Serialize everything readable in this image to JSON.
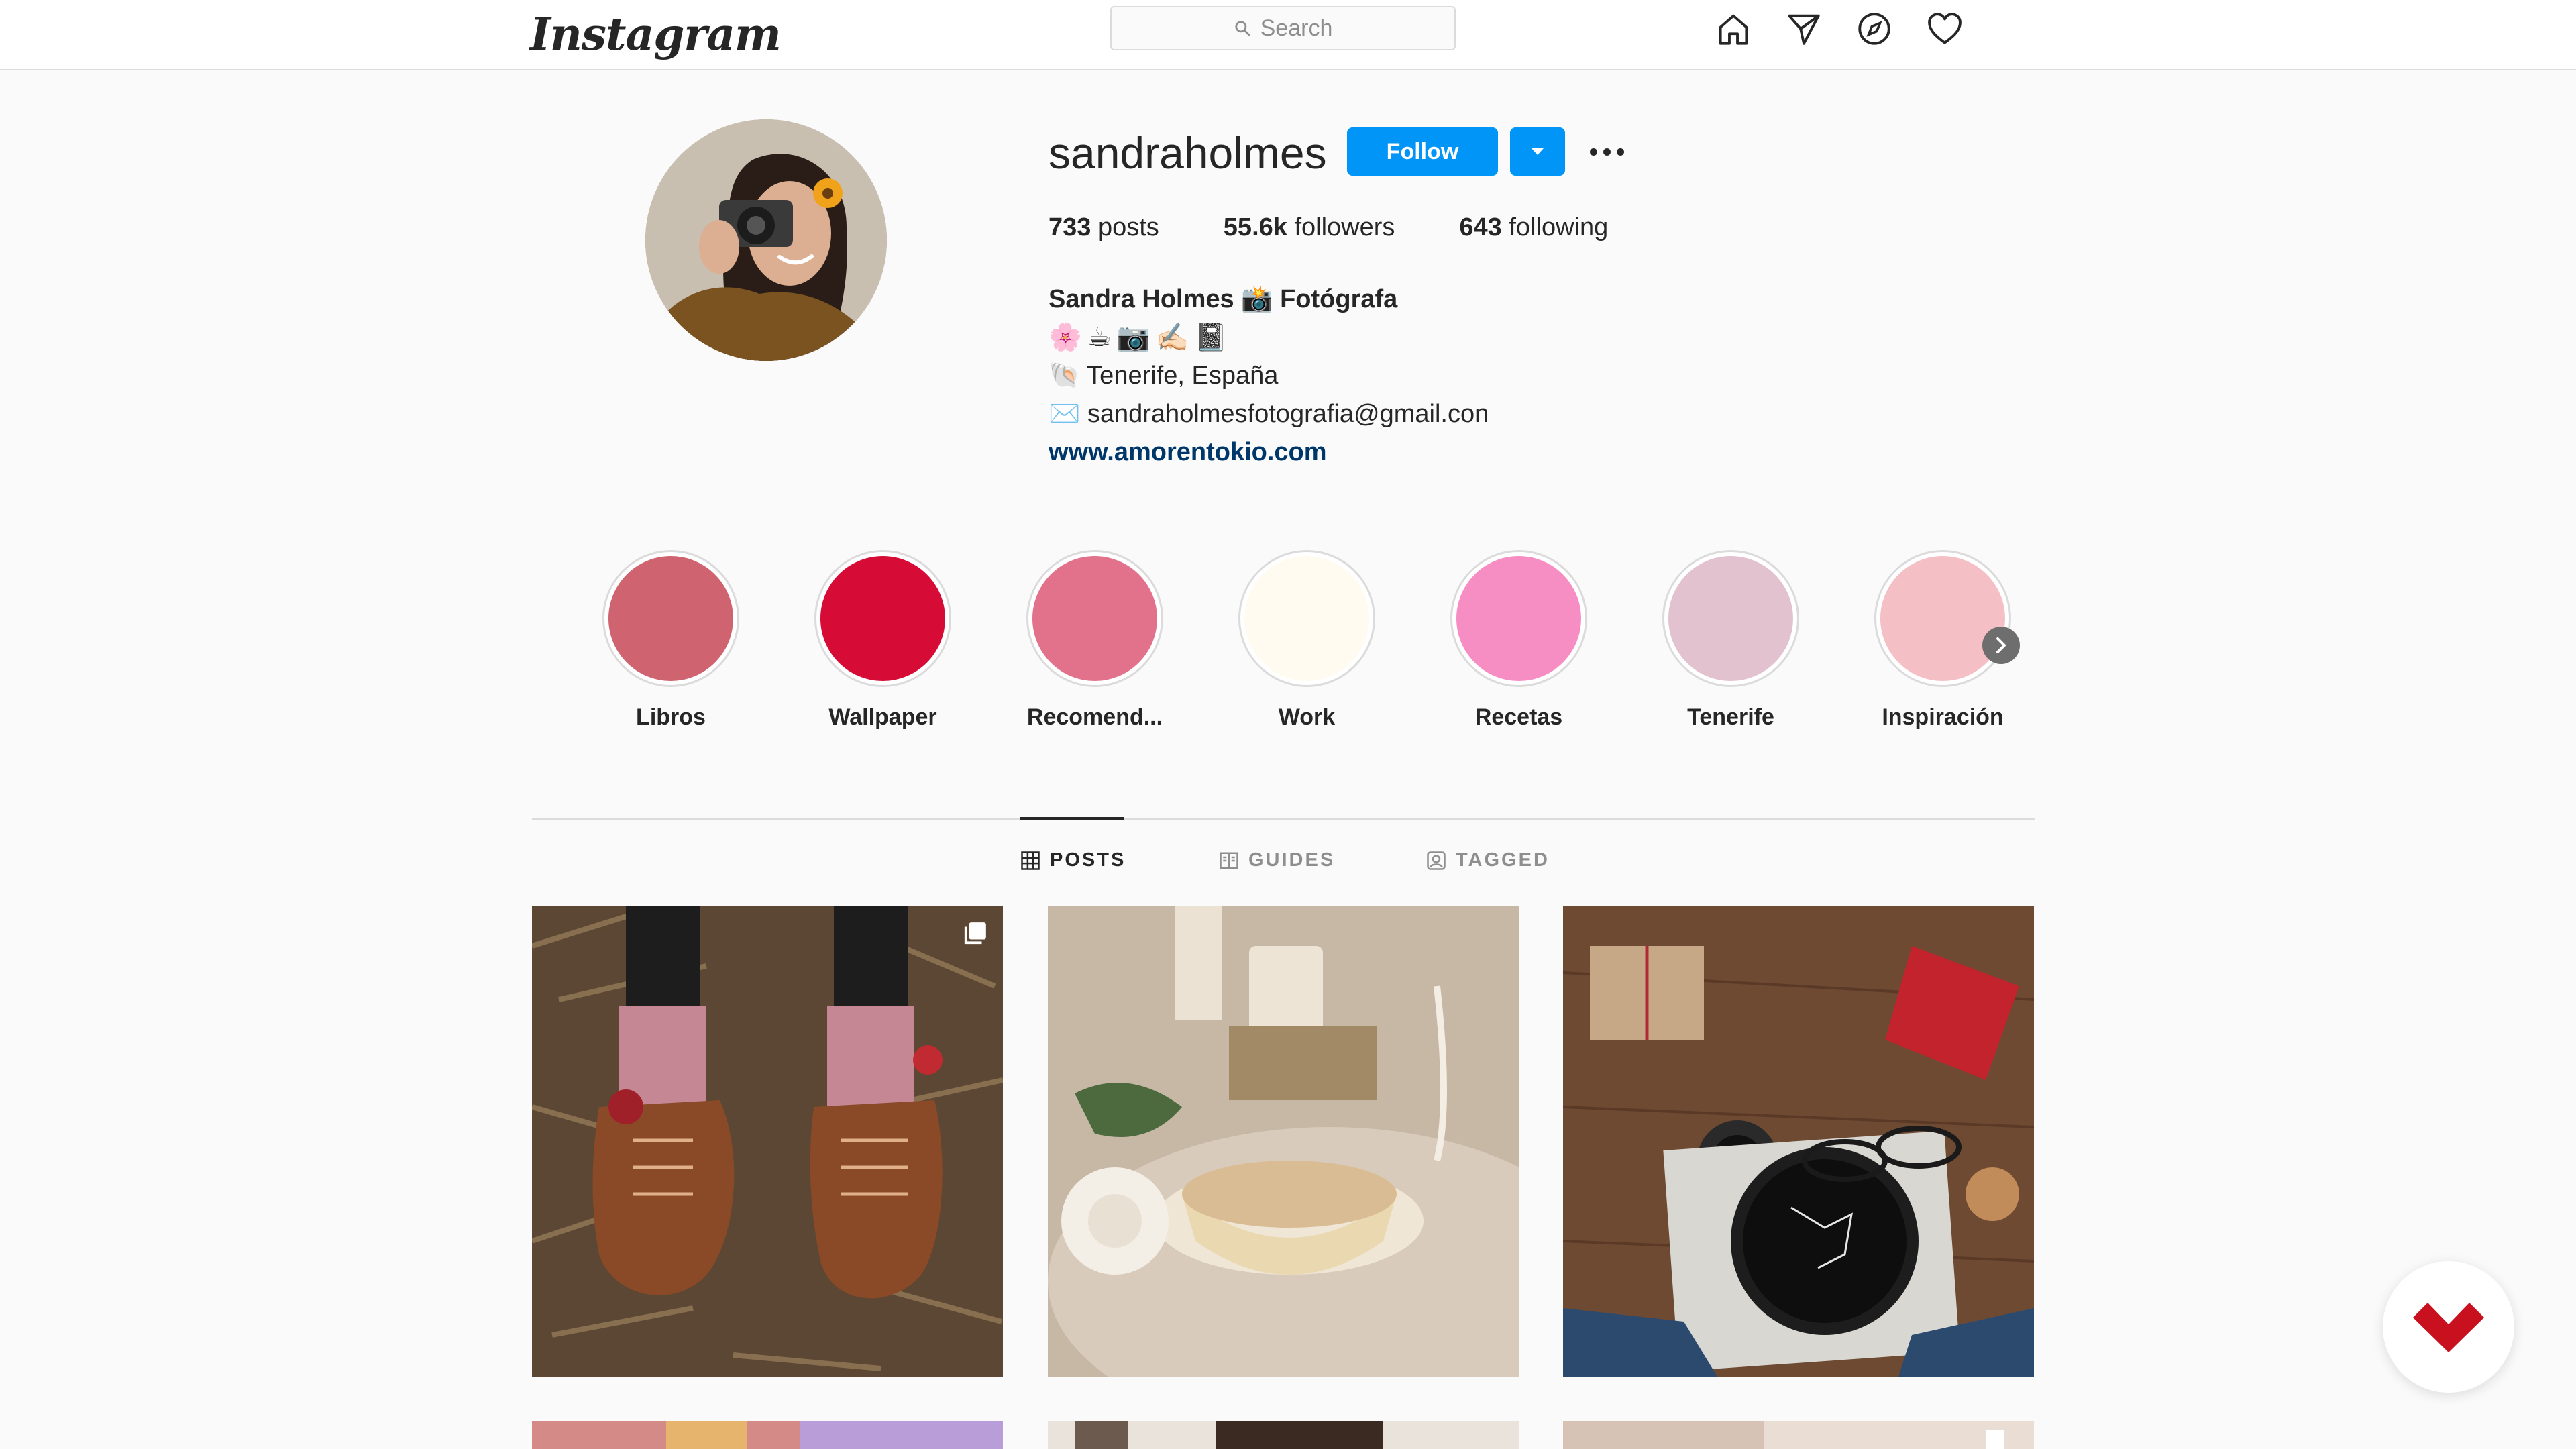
{
  "app": {
    "logo_text": "Instagram"
  },
  "search": {
    "placeholder": "Search"
  },
  "nav_icons": [
    "home-icon",
    "direct-icon",
    "explore-icon",
    "activity-icon"
  ],
  "profile": {
    "username": "sandraholmes",
    "follow_label": "Follow",
    "stats": {
      "posts": "733",
      "posts_label": "posts",
      "followers": "55.6k",
      "followers_label": "followers",
      "following": "643",
      "following_label": "following"
    },
    "bio": {
      "name": "Sandra Holmes 📸 Fotógrafa",
      "emojis": [
        "🌸",
        "☕",
        "📷",
        "✍🏻",
        "📓"
      ],
      "location": "🐚 Tenerife, España",
      "email": "✉️ sandraholmesfotografia@gmail.con",
      "website": "www.amorentokio.com"
    }
  },
  "highlights": [
    {
      "label": "Libros",
      "color": "#cf6470"
    },
    {
      "label": "Wallpaper",
      "color": "#d70c36"
    },
    {
      "label": "Recomend...",
      "color": "#e2728b"
    },
    {
      "label": "Work",
      "color": "#fffbf0"
    },
    {
      "label": "Recetas",
      "color": "#f68ec4"
    },
    {
      "label": "Tenerife",
      "color": "#e3c2cf"
    },
    {
      "label": "Inspiración",
      "color": "#f5bfc6"
    }
  ],
  "tabs": [
    {
      "label": "POSTS",
      "active": true,
      "icon": "grid-icon"
    },
    {
      "label": "GUIDES",
      "active": false,
      "icon": "guides-icon"
    },
    {
      "label": "TAGGED",
      "active": false,
      "icon": "tagged-icon"
    }
  ],
  "colors": {
    "accent": "#0095f6",
    "link": "#00376b",
    "text": "#262626",
    "muted": "#8e8e8e"
  }
}
